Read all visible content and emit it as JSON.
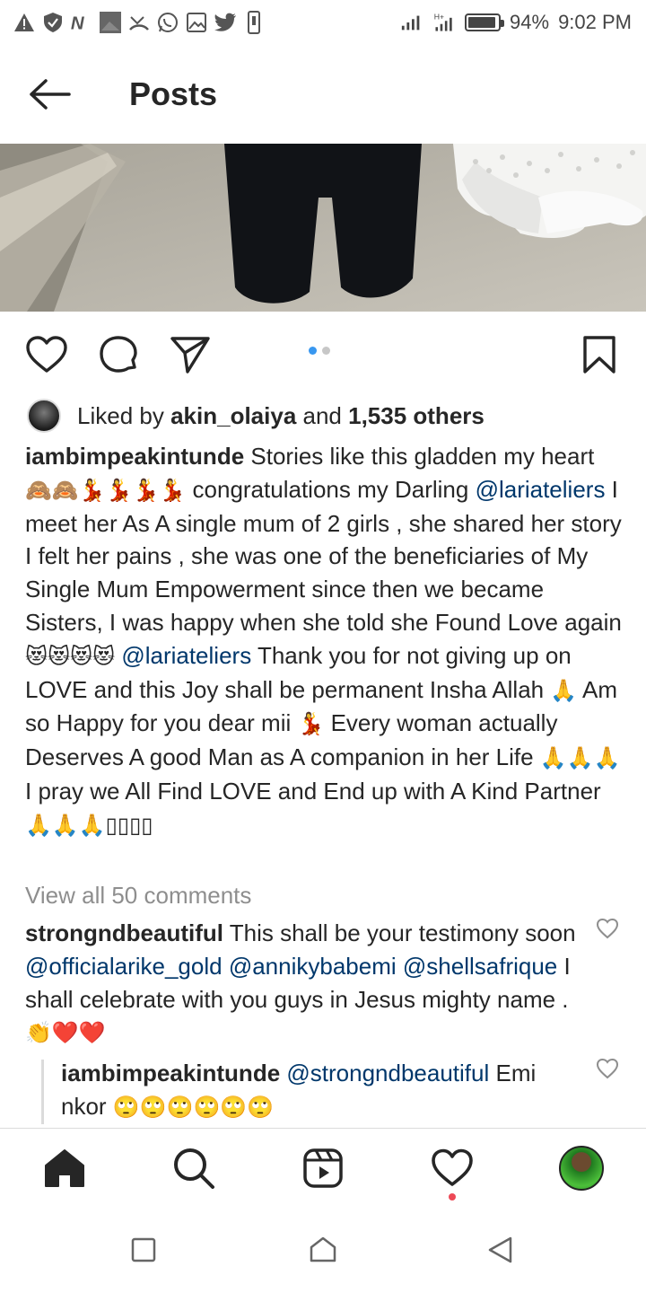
{
  "status_bar": {
    "battery_percent": "94%",
    "time": "9:02 PM",
    "battery_level": 0.94,
    "left_icons": [
      "warning-icon",
      "shield-icon",
      "n-app-icon",
      "image-box-icon",
      "missed-call-icon",
      "whatsapp-icon",
      "gallery-icon",
      "twitter-icon",
      "phone-vibrate-icon"
    ]
  },
  "header": {
    "title": "Posts"
  },
  "post": {
    "carousel": {
      "total": 2,
      "active": 1
    },
    "likes": {
      "prefix": "Liked by ",
      "first_user": "akin_olaiya",
      "middle": " and ",
      "others": "1,535 others"
    },
    "caption": {
      "user": "iambimpeakintunde",
      "t1": " Stories like this gladden my heart ",
      "e1": "🙈🙈💃💃💃💃",
      "t2": " congratulations my Darling ",
      "m1": "@lariateliers",
      "t3": "  I meet her As A single mum of 2 girls , she shared her story I felt her pains , she was one of the beneficiaries of My Single Mum Empowerment since then we became Sisters, I was happy when she told she Found Love again ",
      "e2": "😻😻😻😻",
      "t4": " ",
      "m2": "@lariateliers",
      "t5": " Thank you for not giving up on LOVE and this Joy shall be permanent Insha Allah ",
      "e3": "🙏",
      "t6": " Am so Happy for you dear mii ",
      "e4": "💃",
      "t7": " Every woman actually Deserves A good Man as A companion in her Life ",
      "e5": "🙏🙏🙏",
      "t8": " I pray we All Find LOVE and End up with A Kind Partner ",
      "e6": "🙏🙏🙏",
      "e7": "▯▯▯▯"
    },
    "view_all_comments": "View all 50 comments",
    "comments": [
      {
        "user": "strongndbeautiful",
        "t1": " This shall be your testimony soon ",
        "m1": "@officialarike_gold",
        "t2": " ",
        "m2": "@annikybabemi",
        "t3": " ",
        "m3": "@shellsafrique",
        "t4": " I shall celebrate with you guys in Jesus mighty name . ",
        "e1": "👏❤️❤️"
      }
    ],
    "reply": {
      "user": "iambimpeakintunde",
      "t1": " ",
      "m1": "@strongndbeautiful",
      "t2": " Emi nkor ",
      "e1": "🙄🙄🙄🙄🙄🙄"
    }
  },
  "bottom_nav": {
    "items": [
      "home-icon",
      "search-icon",
      "reels-icon",
      "activity-heart-icon",
      "profile-avatar"
    ],
    "active": "home-icon"
  },
  "system_nav": {
    "items": [
      "recents-square-icon",
      "home-circle-icon",
      "back-triangle-icon"
    ]
  },
  "colors": {
    "text": "#262626",
    "mention": "#00376b",
    "muted": "#8e8e8e",
    "carousel_active": "#3897f0",
    "notification": "#ed4956"
  }
}
